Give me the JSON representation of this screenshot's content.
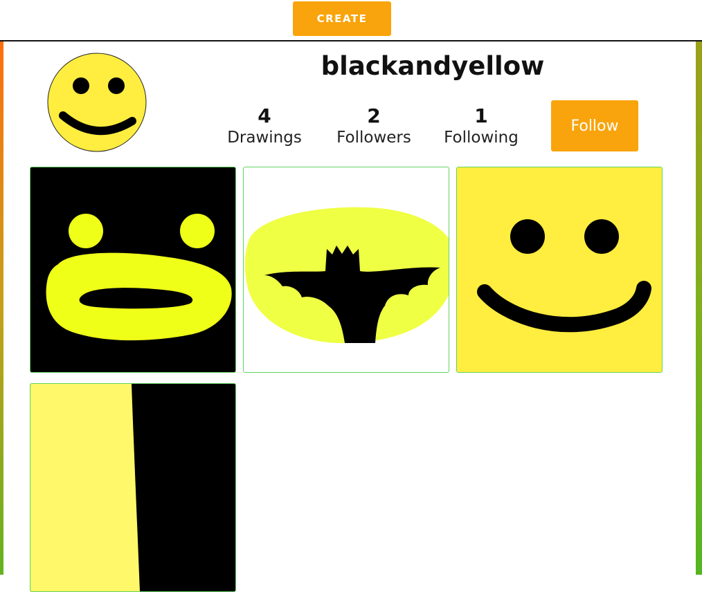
{
  "header": {
    "create_label": "CREATE"
  },
  "profile": {
    "username": "blackandyellow",
    "stats": [
      {
        "value": "4",
        "label": "Drawings"
      },
      {
        "value": "2",
        "label": "Followers"
      },
      {
        "value": "1",
        "label": "Following"
      }
    ],
    "follow_label": "Follow"
  },
  "colors": {
    "accent": "#f9a40c",
    "yellow": "#ffed3f",
    "lime_yellow": "#efff18",
    "tile_border": "#5fd35f"
  },
  "drawings": [
    {
      "icon": "black-face-drawing"
    },
    {
      "icon": "bat-signal-drawing"
    },
    {
      "icon": "smiley-drawing"
    },
    {
      "icon": "yellow-black-split-drawing"
    }
  ]
}
